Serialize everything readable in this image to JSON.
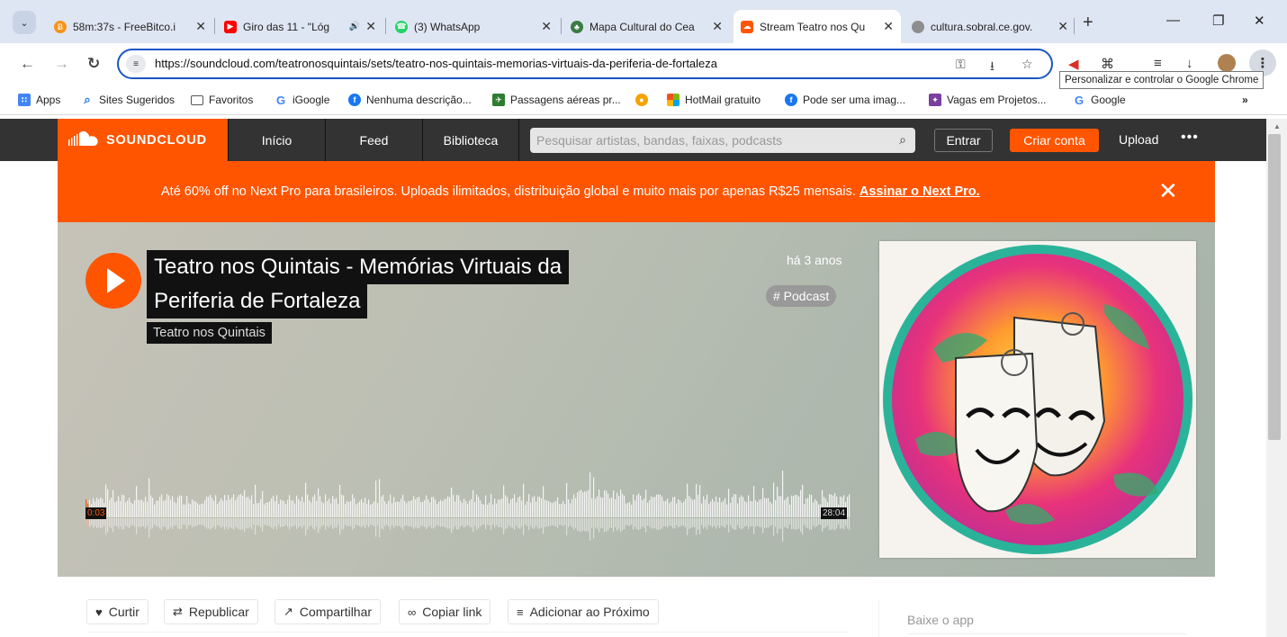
{
  "browser": {
    "tabs": [
      {
        "title": "58m:37s - FreeBitco.i",
        "favicon_color": "#f7931a",
        "favicon_glyph": "Ƀ",
        "active": false
      },
      {
        "title": "Giro das 11 - \"Lóg",
        "favicon_color": "#ff0000",
        "favicon_glyph": "▶",
        "active": false,
        "audio": true
      },
      {
        "title": "(3) WhatsApp",
        "favicon_color": "#25d366",
        "favicon_glyph": "☎",
        "active": false
      },
      {
        "title": "Mapa Cultural do Cea",
        "favicon_color": "#3a7d44",
        "favicon_glyph": "♣",
        "active": false
      },
      {
        "title": "Stream Teatro nos Qu",
        "favicon_color": "#ff5500",
        "favicon_glyph": "☁",
        "active": true
      },
      {
        "title": "cultura.sobral.ce.gov.",
        "favicon_color": "#8e8e8e",
        "favicon_glyph": "●",
        "active": false
      }
    ],
    "url": "https://soundcloud.com/teatronosquintais/sets/teatro-nos-quintais-memorias-virtuais-da-periferia-de-fortaleza",
    "tooltip": "Personalizar e controlar o Google Chrome",
    "bookmarks": [
      {
        "label": "Apps",
        "icon": "apps-grid-icon",
        "color": "#4285f4"
      },
      {
        "label": "Sites Sugeridos",
        "icon": "search-icon",
        "color": "#1a73e8"
      },
      {
        "label": "Favoritos",
        "icon": "folder-icon",
        "color": "#555555"
      },
      {
        "label": "iGoogle",
        "icon": "google-icon",
        "color": "#4285f4"
      },
      {
        "label": "Nenhuma descrição...",
        "icon": "facebook-icon",
        "color": "#1877f2"
      },
      {
        "label": "Passagens aéreas pr...",
        "icon": "plane-icon",
        "color": "#2e7d32"
      },
      {
        "label": "",
        "icon": "globe-icon",
        "color": "#f4a300"
      },
      {
        "label": "HotMail gratuito",
        "icon": "windows-icon",
        "color": "#f25022"
      },
      {
        "label": "Pode ser uma imag...",
        "icon": "facebook-icon",
        "color": "#1877f2"
      },
      {
        "label": "Vagas em Projetos...",
        "icon": "jobs-icon",
        "color": "#7b3fa0"
      },
      {
        "label": "Google",
        "icon": "google-icon",
        "color": "#4285f4"
      }
    ]
  },
  "soundcloud": {
    "logo_text": "SOUNDCLOUD",
    "nav": [
      "Início",
      "Feed",
      "Biblioteca"
    ],
    "search_placeholder": "Pesquisar artistas, bandas, faixas, podcasts",
    "signin_label": "Entrar",
    "signup_label": "Criar conta",
    "upload_label": "Upload",
    "more_label": "•••",
    "promo_text": "Até 60% off no Next Pro para brasileiros. Uploads ilimitados, distribuição global e muito mais por apenas R$25 mensais. ",
    "promo_link": "Assinar o Next Pro.",
    "accent_color": "#ff5500",
    "playlist": {
      "title_line1": "Teatro nos Quintais - Memórias Virtuais da",
      "title_line2": "Periferia de Fortaleza",
      "artist": "Teatro nos Quintais",
      "posted": "há 3 anos",
      "tag": "# Podcast",
      "time_elapsed": "0:03",
      "duration": "28:04"
    },
    "actions": [
      {
        "label": "Curtir",
        "icon": "heart-icon"
      },
      {
        "label": "Republicar",
        "icon": "repost-icon"
      },
      {
        "label": "Compartilhar",
        "icon": "share-icon"
      },
      {
        "label": "Copiar link",
        "icon": "link-icon"
      },
      {
        "label": "Adicionar ao Próximo",
        "icon": "add-to-queue-icon"
      }
    ],
    "sidebar_app_label": "Baixe o app"
  }
}
